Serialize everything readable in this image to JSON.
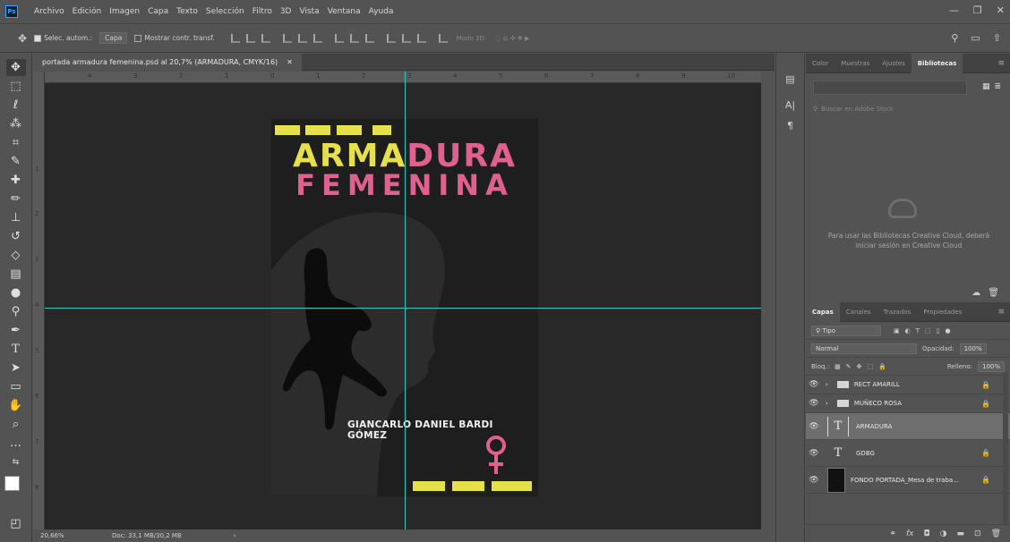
{
  "app": {
    "logo": "Ps",
    "menu": [
      "Archivo",
      "Edición",
      "Imagen",
      "Capa",
      "Texto",
      "Selección",
      "Filtro",
      "3D",
      "Vista",
      "Ventana",
      "Ayuda"
    ]
  },
  "options_bar": {
    "auto_select_label": "Selec. autom.:",
    "auto_select_target": "Capa",
    "show_transform_label": "Mostrar contr. transf.",
    "mode_3d_label": "Modo 3D:"
  },
  "document": {
    "tab_title": "portada armadura femenina.psd al 20,7% (ARMADURA, CMYK/16)",
    "ruler_h": [
      "4",
      "3",
      "2",
      "1",
      "0",
      "1",
      "2",
      "3",
      "4",
      "5",
      "6",
      "7",
      "8",
      "9",
      "10"
    ],
    "ruler_v": [
      "1",
      "2",
      "3",
      "4",
      "5",
      "6",
      "7",
      "8"
    ],
    "zoom": "20,66%",
    "doc_size": "Doc: 33,1 MB/30,2 MB"
  },
  "cover": {
    "title_line1_yellow": "ARMA",
    "title_line1_pink": "DURA",
    "title_line2": "FEMENINA",
    "author": "GIANCARLO DANIEL BARDI GÓMEZ",
    "colors": {
      "yellow": "#e6e04a",
      "pink": "#e0608f",
      "background": "#1e1e1e"
    }
  },
  "libraries_panel": {
    "tabs": [
      "Color",
      "Muestras",
      "Ajustes",
      "Bibliotecas"
    ],
    "active_tab": "Bibliotecas",
    "search_placeholder": "Buscar en Adobe Stock",
    "message": "Para usar las Bibliotecas Creative Cloud, deberá iniciar sesión en Creative Cloud"
  },
  "layers_panel": {
    "tabs": [
      "Capas",
      "Canales",
      "Trazados",
      "Propiedades"
    ],
    "active_tab": "Capas",
    "filter_label": "Tipo",
    "blend_mode": "Normal",
    "opacity_label": "Opacidad:",
    "opacity_value": "100%",
    "lock_label": "Bloq.:",
    "fill_label": "Relleno:",
    "fill_value": "100%",
    "layers": [
      {
        "name": "RECT AMARILL",
        "kind": "group",
        "locked": true,
        "selected": false
      },
      {
        "name": "MUÑECO ROSA",
        "kind": "group",
        "locked": true,
        "selected": false
      },
      {
        "name": "ARMADURA",
        "kind": "text",
        "locked": false,
        "selected": true
      },
      {
        "name": "GDBG",
        "kind": "text",
        "locked": true,
        "selected": false
      },
      {
        "name": "FONDO PORTADA_Mesa de traba...",
        "kind": "smart-object",
        "locked": true,
        "selected": false
      }
    ]
  }
}
